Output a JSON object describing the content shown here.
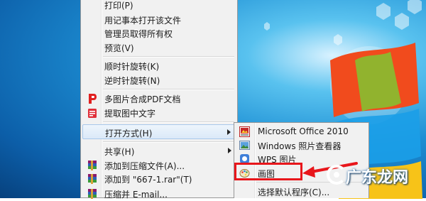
{
  "colors": {
    "highlight_box": "#e8161b",
    "menu_bg": "#f1f1f1",
    "desktop_blue": "#1d8fd4"
  },
  "context_menu": {
    "items": [
      {
        "label": "打印(P)"
      },
      {
        "label": "用记事本打开该文件"
      },
      {
        "label": "管理员取得所有权"
      },
      {
        "label": "预览(V)"
      },
      {
        "label": "顺时针旋转(K)"
      },
      {
        "label": "逆时针旋转(N)"
      },
      {
        "label": "多图片合成PDF文档",
        "icon": "pdf-icon"
      },
      {
        "label": "提取图中文字",
        "icon": "text-extract-icon"
      },
      {
        "label": "打开方式(H)",
        "submenu": true
      },
      {
        "label": "共享(H)",
        "submenu": true
      },
      {
        "label": "添加到压缩文件(A)...",
        "icon": "winrar-icon"
      },
      {
        "label": "添加到 \"667-1.rar\"(T)",
        "icon": "winrar-icon"
      },
      {
        "label": "压缩并 E-mail...",
        "icon": "winrar-icon"
      }
    ]
  },
  "open_with_submenu": {
    "items": [
      {
        "label": "Microsoft Office 2010",
        "icon": "office-picture-icon"
      },
      {
        "label": "Windows 照片查看器",
        "icon": "photo-viewer-icon"
      },
      {
        "label": "WPS 图片",
        "icon": "wps-picture-icon"
      },
      {
        "label": "画图",
        "icon": "paint-icon"
      },
      {
        "label": "选择默认程序(C)..."
      }
    ]
  },
  "watermark": {
    "text": "广东龙网"
  }
}
